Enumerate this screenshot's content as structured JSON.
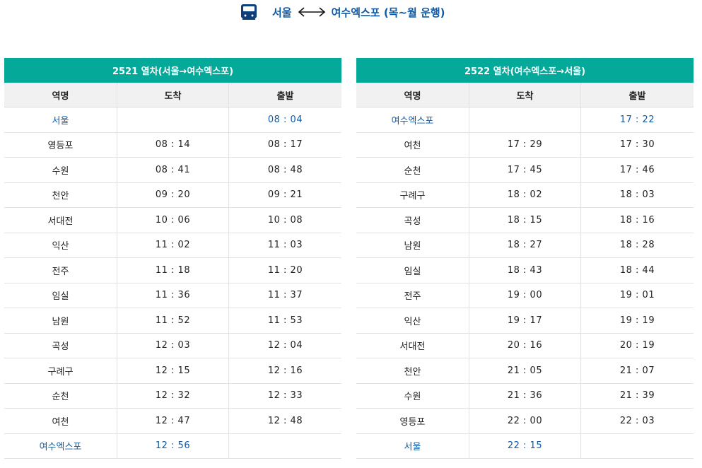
{
  "route": {
    "origin": "서울",
    "destination": "여수엑스포 (목~월 운행)"
  },
  "tables": [
    {
      "title": "2521 열차(서울→여수엑스포)",
      "headers": [
        "역명",
        "도착",
        "출발"
      ],
      "rows": [
        {
          "station": "서울",
          "arrive": "",
          "depart": "08 : 04",
          "highlight": true
        },
        {
          "station": "영등포",
          "arrive": "08 : 14",
          "depart": "08 : 17",
          "highlight": false
        },
        {
          "station": "수원",
          "arrive": "08 : 41",
          "depart": "08 : 48",
          "highlight": false
        },
        {
          "station": "천안",
          "arrive": "09 : 20",
          "depart": "09 : 21",
          "highlight": false
        },
        {
          "station": "서대전",
          "arrive": "10 : 06",
          "depart": "10 : 08",
          "highlight": false
        },
        {
          "station": "익산",
          "arrive": "11 : 02",
          "depart": "11 : 03",
          "highlight": false
        },
        {
          "station": "전주",
          "arrive": "11 : 18",
          "depart": "11 : 20",
          "highlight": false
        },
        {
          "station": "임실",
          "arrive": "11 : 36",
          "depart": "11 : 37",
          "highlight": false
        },
        {
          "station": "남원",
          "arrive": "11 : 52",
          "depart": "11 : 53",
          "highlight": false
        },
        {
          "station": "곡성",
          "arrive": "12 : 03",
          "depart": "12 : 04",
          "highlight": false
        },
        {
          "station": "구례구",
          "arrive": "12 : 15",
          "depart": "12 : 16",
          "highlight": false
        },
        {
          "station": "순천",
          "arrive": "12 : 32",
          "depart": "12 : 33",
          "highlight": false
        },
        {
          "station": "여천",
          "arrive": "12 : 47",
          "depart": "12 : 48",
          "highlight": false
        },
        {
          "station": "여수엑스포",
          "arrive": "12 : 56",
          "depart": "",
          "highlight": true
        }
      ]
    },
    {
      "title": "2522 열차(여수엑스포→서울)",
      "headers": [
        "역명",
        "도착",
        "출발"
      ],
      "rows": [
        {
          "station": "여수엑스포",
          "arrive": "",
          "depart": "17 : 22",
          "highlight": true
        },
        {
          "station": "여천",
          "arrive": "17 : 29",
          "depart": "17 : 30",
          "highlight": false
        },
        {
          "station": "순천",
          "arrive": "17 : 45",
          "depart": "17 : 46",
          "highlight": false
        },
        {
          "station": "구례구",
          "arrive": "18 : 02",
          "depart": "18 : 03",
          "highlight": false
        },
        {
          "station": "곡성",
          "arrive": "18 : 15",
          "depart": "18 : 16",
          "highlight": false
        },
        {
          "station": "남원",
          "arrive": "18 : 27",
          "depart": "18 : 28",
          "highlight": false
        },
        {
          "station": "임실",
          "arrive": "18 : 43",
          "depart": "18 : 44",
          "highlight": false
        },
        {
          "station": "전주",
          "arrive": "19 : 00",
          "depart": "19 : 01",
          "highlight": false
        },
        {
          "station": "익산",
          "arrive": "19 : 17",
          "depart": "19 : 19",
          "highlight": false
        },
        {
          "station": "서대전",
          "arrive": "20 : 16",
          "depart": "20 : 19",
          "highlight": false
        },
        {
          "station": "천안",
          "arrive": "21 : 05",
          "depart": "21 : 07",
          "highlight": false
        },
        {
          "station": "수원",
          "arrive": "21 : 36",
          "depart": "21 : 39",
          "highlight": false
        },
        {
          "station": "영등포",
          "arrive": "22 : 00",
          "depart": "22 : 03",
          "highlight": false
        },
        {
          "station": "서울",
          "arrive": "22 : 15",
          "depart": "",
          "highlight": true
        }
      ]
    }
  ],
  "icons": {
    "train": "train-icon",
    "route_arrow": "double-arrow-icon"
  },
  "colors": {
    "header_bar": "#05a99a",
    "accent_text": "#0e5aa7",
    "column_header_bg": "#f1f1f1"
  }
}
